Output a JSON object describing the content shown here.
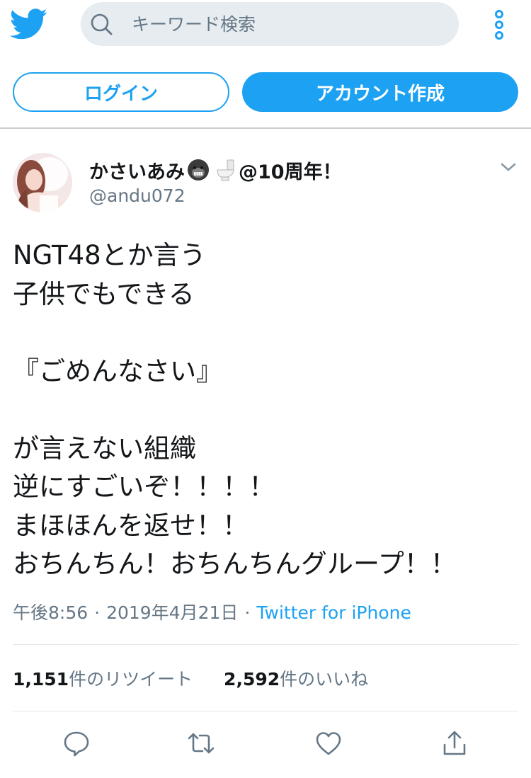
{
  "colors": {
    "brand_blue": "#1da1f2",
    "text_primary": "#14171a",
    "text_secondary": "#657786",
    "search_bg": "#e6ecf0",
    "divider": "#e1e8ed"
  },
  "header": {
    "logo_icon": "twitter-bird-icon",
    "search": {
      "icon": "search-icon",
      "placeholder": "キーワード検索",
      "value": ""
    },
    "more_icon": "more-vertical-icon"
  },
  "auth": {
    "login_label": "ログイン",
    "signup_label": "アカウント作成"
  },
  "tweet": {
    "user": {
      "name_prefix": "かさいあみ",
      "name_emojis": [
        "gorilla-emoji-icon",
        "toilet-emoji-icon"
      ],
      "name_suffix": "@10周年！",
      "handle": "@andu072"
    },
    "menu_icon": "chevron-down-icon",
    "text": "NGT48とか言う\n子供でもできる\n\n『ごめんなさい』\n\nが言えない組織\n逆にすごいぞ！！！！\nまほほんを返せ！！\nおちんちん！おちんちんグループ！！",
    "time": "午後8:56",
    "date": "2019年4月21日",
    "separator": "·",
    "source": "Twitter for iPhone",
    "stats": {
      "retweets_count": "1,151",
      "retweets_label": "件のリツイート",
      "likes_count": "2,592",
      "likes_label": "件のいいね"
    },
    "actions": [
      {
        "name": "reply",
        "icon": "reply-icon"
      },
      {
        "name": "retweet",
        "icon": "retweet-icon"
      },
      {
        "name": "like",
        "icon": "heart-icon"
      },
      {
        "name": "share",
        "icon": "share-icon"
      }
    ]
  }
}
